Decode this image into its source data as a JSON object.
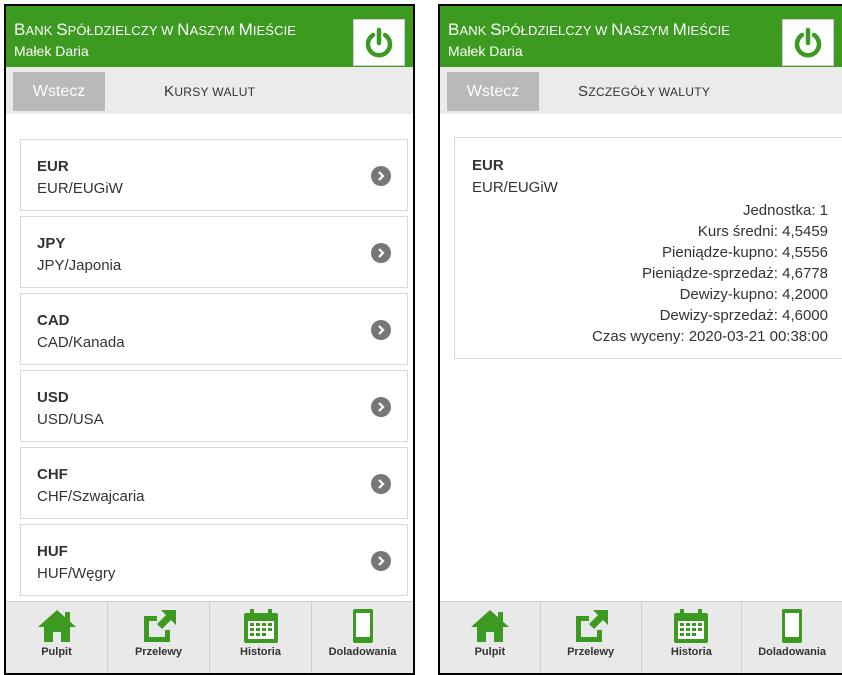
{
  "app": {
    "bank_name_parts": [
      {
        "text": "B",
        "sc": false
      },
      {
        "text": "ANK ",
        "sc": true
      },
      {
        "text": "S",
        "sc": false
      },
      {
        "text": "PÓŁDZIELCZY W ",
        "sc": true
      },
      {
        "text": "N",
        "sc": false
      },
      {
        "text": "ASZYM ",
        "sc": true
      },
      {
        "text": "M",
        "sc": false
      },
      {
        "text": "IEŚCIE",
        "sc": true
      }
    ],
    "user_name": "Małek Daria",
    "back_label": "Wstecz",
    "accent_color": "#3c9a20"
  },
  "left_screen": {
    "title_parts": [
      {
        "text": "K",
        "sc": false
      },
      {
        "text": "URSY WALUT",
        "sc": true
      }
    ],
    "currencies": [
      {
        "code": "EUR",
        "name": "EUR/EUGiW"
      },
      {
        "code": "JPY",
        "name": "JPY/Japonia"
      },
      {
        "code": "CAD",
        "name": "CAD/Kanada"
      },
      {
        "code": "USD",
        "name": "USD/USA"
      },
      {
        "code": "CHF",
        "name": "CHF/Szwajcaria"
      },
      {
        "code": "HUF",
        "name": "HUF/Węgry"
      }
    ]
  },
  "right_screen": {
    "title_parts": [
      {
        "text": "S",
        "sc": false
      },
      {
        "text": "ZCZEGÓŁY WALUTY",
        "sc": true
      }
    ],
    "detail": {
      "code": "EUR",
      "name": "EUR/EUGiW",
      "rows": [
        "Jednostka: 1",
        "Kurs średni: 4,5459",
        "Pieniądze-kupno: 4,5556",
        "Pieniądze-sprzedaż: 4,6778",
        "Dewizy-kupno: 4,2000",
        "Dewizy-sprzedaż: 4,6000",
        "Czas wyceny: 2020-03-21 00:38:00"
      ]
    }
  },
  "nav": [
    {
      "label": "Pulpit",
      "icon": "home-icon"
    },
    {
      "label": "Przelewy",
      "icon": "transfer-icon"
    },
    {
      "label": "Historia",
      "icon": "calendar-icon"
    },
    {
      "label": "Doladowania",
      "icon": "phone-icon"
    }
  ]
}
